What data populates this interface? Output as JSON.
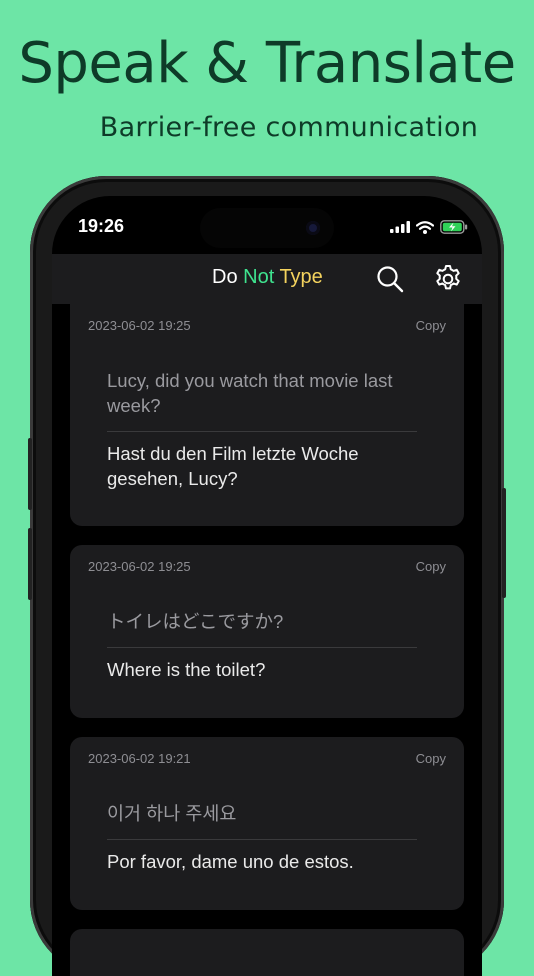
{
  "promo": {
    "headline": "Speak & Translate",
    "subheadline": "Barrier-free communication"
  },
  "status_bar": {
    "time": "19:26",
    "icons": [
      "cellular-signal-icon",
      "wifi-icon",
      "battery-charging-icon"
    ]
  },
  "app_bar": {
    "title_part1": "Do ",
    "title_part2": "Not",
    "title_part3": " Type",
    "title_colors": {
      "do": "#ffffff",
      "not": "#3fe38f",
      "type": "#f4d35e"
    },
    "search_icon": "search-icon",
    "settings_icon": "gear-icon"
  },
  "colors": {
    "background": "#6de5a6",
    "card": "#1c1c1e",
    "screen": "#000000"
  },
  "cards": [
    {
      "timestamp": "2023-06-02 19:25",
      "copy_label": "Copy",
      "source_text": "Lucy, did you watch that movie last week?",
      "translated_text": "Hast du den Film letzte Woche gesehen, Lucy?"
    },
    {
      "timestamp": "2023-06-02 19:25",
      "copy_label": "Copy",
      "source_text": "トイレはどこですか?",
      "translated_text": "Where is the toilet?"
    },
    {
      "timestamp": "2023-06-02 19:21",
      "copy_label": "Copy",
      "source_text": "이거 하나 주세요",
      "translated_text": "Por favor, dame uno de estos."
    }
  ]
}
